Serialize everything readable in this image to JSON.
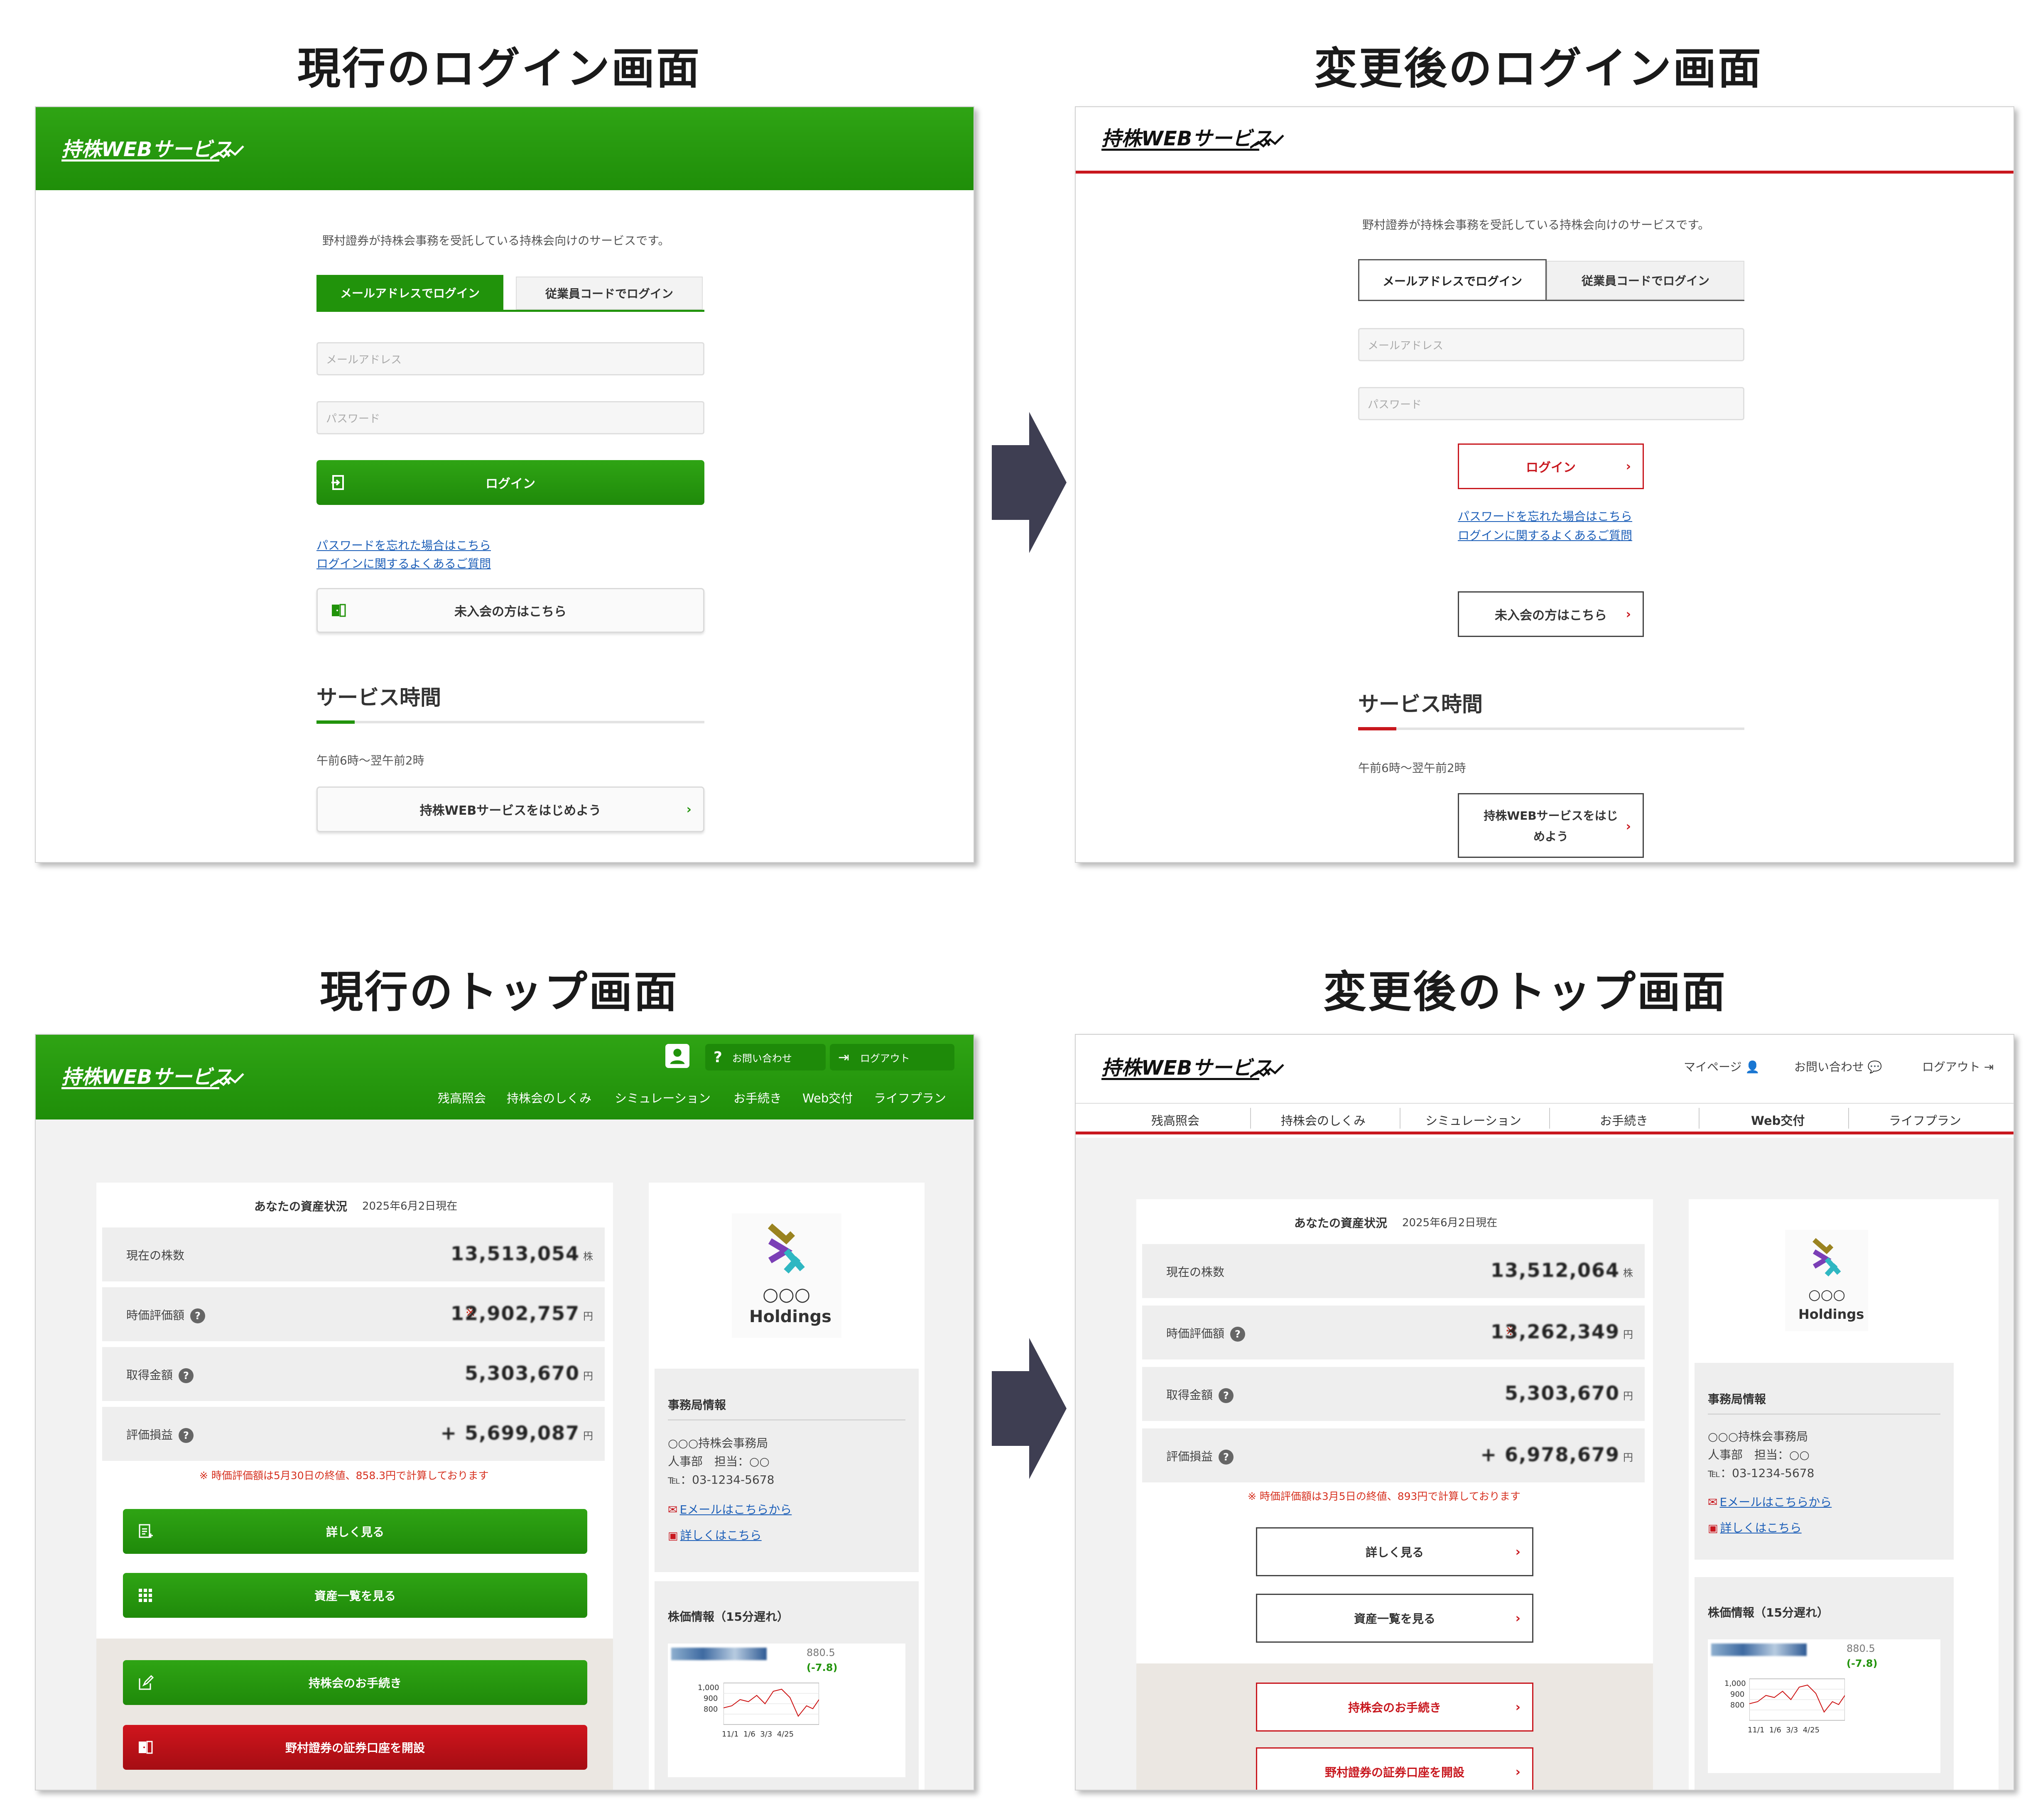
{
  "titles": {
    "current_login": "現行のログイン画面",
    "new_login": "変更後のログイン画面",
    "current_top": "現行のトップ画面",
    "new_top": "変更後のトップ画面"
  },
  "brand": {
    "logo": "持株WEBサービス",
    "green": "#21930b",
    "red": "#c8171e"
  },
  "login": {
    "intro": "野村證券が持株会事務を受託している持株会向けのサービスです。",
    "tab_email": "メールアドレスでログイン",
    "tab_employee": "従業員コードでログイン",
    "email_placeholder": "メールアドレス",
    "password_placeholder": "パスワード",
    "login_button": "ログイン",
    "forgot_link": "パスワードを忘れた場合はこちら",
    "faq_link": "ログインに関するよくあるご質問",
    "join_button": "未入会の方はこちら",
    "service_heading": "サービス時間",
    "service_hours": "午前6時～翌午前2時",
    "start_button": "持株WEBサービスをはじめよう",
    "start_button_l1": "持株WEBサービスをはじ",
    "start_button_l2": "めよう",
    "chevron": "›"
  },
  "top": {
    "header_links": {
      "contact": "お問い合わせ",
      "logout": "ログアウト",
      "mypage": "マイページ",
      "help": "?"
    },
    "nav": [
      "残高照会",
      "持株会のしくみ",
      "シミュレーション",
      "お手続き",
      "Web交付",
      "ライフプラン"
    ],
    "assets_title": "あなたの資産状況",
    "date_current": "2025年6月2日現在",
    "rows": [
      {
        "label": "現在の株数",
        "value_current": "13,513,054",
        "value_new": "13,512,064",
        "unit": "株"
      },
      {
        "label": "時価評価額",
        "value_current": "12,902,757",
        "value_new": "13,262,349",
        "unit": "円",
        "mark": "※"
      },
      {
        "label": "取得金額",
        "value_current": "5,303,670",
        "value_new": "5,303,670",
        "unit": "円"
      },
      {
        "label": "評価損益",
        "value_current": "+ 5,699,087",
        "value_new": "+ 6,978,679",
        "unit": "円"
      }
    ],
    "note_current": "※ 時価評価額は5月30日の終値、858.3円で計算しております",
    "note_new": "※ 時価評価額は3月5日の終値、893円で計算しております",
    "btn_detail": "詳しく見る",
    "btn_assets": "資産一覧を見る",
    "btn_procedure": "持株会のお手続き",
    "btn_account": "野村證券の証券口座を開設",
    "holdings_circles": "○○○",
    "holdings_name": "Holdings",
    "office_title": "事務局情報",
    "office_name": "○○○持株会事務局",
    "office_dept": "人事部　担当：○○",
    "office_tel": "℡：03-1234-5678",
    "office_mail": "Eメールはこちらから",
    "office_detail": "詳しくはこちら",
    "stock_title": "株価情報（15分遅れ）",
    "stock_price": "880.5",
    "stock_change": "(-7.8)",
    "stock_yticks": [
      "1,000",
      "900",
      "800"
    ],
    "stock_xticks": "11/1  1/6  3/3  4/25"
  }
}
